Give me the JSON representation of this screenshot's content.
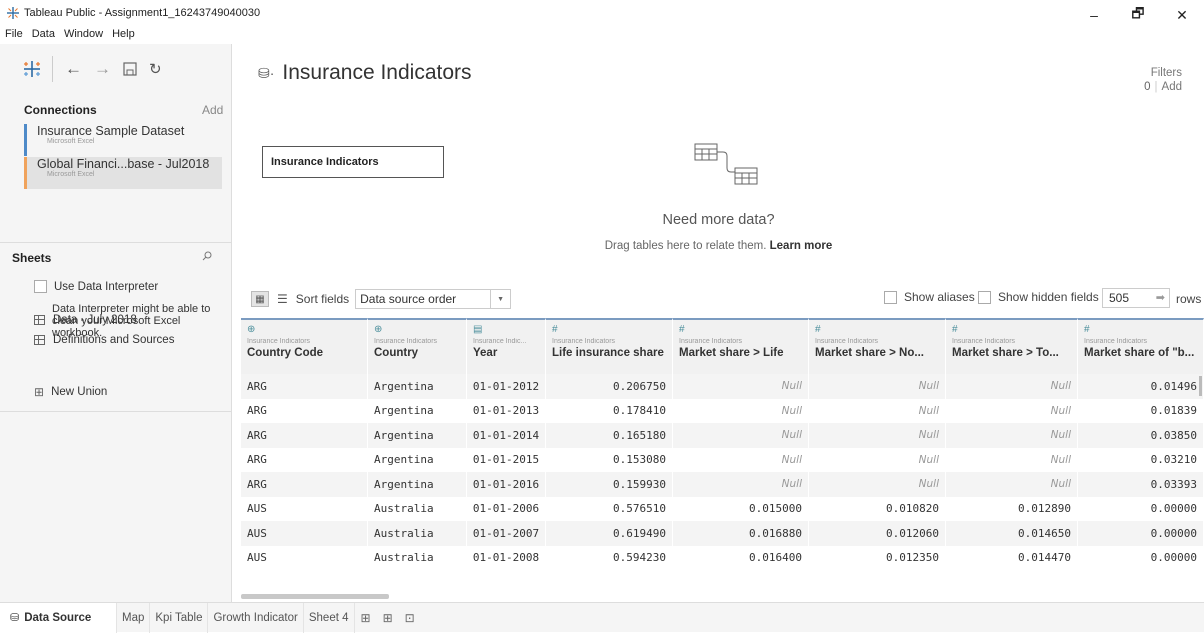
{
  "window": {
    "title": "Tableau Public - Assignment1_16243749040030",
    "minimize": "–",
    "maximize": "🗗",
    "close": "✕"
  },
  "menu": [
    "File",
    "Data",
    "Window",
    "Help"
  ],
  "left": {
    "connections_label": "Connections",
    "add_label": "Add",
    "connections": [
      {
        "name": "Insurance Sample Dataset",
        "type": "Microsoft Excel"
      },
      {
        "name": "Global Financi...base - Jul2018",
        "type": "Microsoft Excel"
      }
    ],
    "sheets_label": "Sheets",
    "use_interpreter": "Use Data Interpreter",
    "interpreter_desc": "Data Interpreter might be able to clean your Microsoft Excel workbook.",
    "sheets": [
      "Data - July 2018",
      "Definitions and Sources"
    ],
    "new_union": "New Union"
  },
  "main": {
    "datasource_title": "Insurance Indicators",
    "filters_label": "Filters",
    "filters_count": "0",
    "filters_add": "Add",
    "canvas_table": "Insurance Indicators",
    "need_more": "Need more data?",
    "drag_text": "Drag tables here to relate them.",
    "learn_more": "Learn more"
  },
  "gridbar": {
    "sort_label": "Sort fields",
    "sort_value": "Data source order",
    "show_aliases": "Show aliases",
    "show_hidden": "Show hidden fields",
    "rows_value": "505",
    "rows_label": "rows"
  },
  "grid": {
    "columns": [
      {
        "icon": "⊕",
        "source": "Insurance Indicators",
        "name": "Country Code"
      },
      {
        "icon": "⊕",
        "source": "Insurance Indicators",
        "name": "Country"
      },
      {
        "icon": "📅",
        "source": "Insurance Indic...",
        "name": "Year"
      },
      {
        "icon": "#",
        "source": "Insurance Indicators",
        "name": "Life insurance share"
      },
      {
        "icon": "#",
        "source": "Insurance Indicators",
        "name": "Market share > Life"
      },
      {
        "icon": "#",
        "source": "Insurance Indicators",
        "name": "Market share > No..."
      },
      {
        "icon": "#",
        "source": "Insurance Indicators",
        "name": "Market share > To..."
      },
      {
        "icon": "#",
        "source": "Insurance Indicators",
        "name": "Market share of \"b..."
      }
    ],
    "rows": [
      [
        "ARG",
        "Argentina",
        "01-01-2012",
        "0.206750",
        "Null",
        "Null",
        "Null",
        "0.01496"
      ],
      [
        "ARG",
        "Argentina",
        "01-01-2013",
        "0.178410",
        "Null",
        "Null",
        "Null",
        "0.01839"
      ],
      [
        "ARG",
        "Argentina",
        "01-01-2014",
        "0.165180",
        "Null",
        "Null",
        "Null",
        "0.03850"
      ],
      [
        "ARG",
        "Argentina",
        "01-01-2015",
        "0.153080",
        "Null",
        "Null",
        "Null",
        "0.03210"
      ],
      [
        "ARG",
        "Argentina",
        "01-01-2016",
        "0.159930",
        "Null",
        "Null",
        "Null",
        "0.03393"
      ],
      [
        "AUS",
        "Australia",
        "01-01-2006",
        "0.576510",
        "0.015000",
        "0.010820",
        "0.012890",
        "0.00000"
      ],
      [
        "AUS",
        "Australia",
        "01-01-2007",
        "0.619490",
        "0.016880",
        "0.012060",
        "0.014650",
        "0.00000"
      ],
      [
        "AUS",
        "Australia",
        "01-01-2008",
        "0.594230",
        "0.016400",
        "0.012350",
        "0.014470",
        "0.00000"
      ]
    ]
  },
  "tabs": {
    "data_source": "Data Source",
    "sheets": [
      "Map",
      "Kpi Table",
      "Growth Indicator",
      "Sheet 4"
    ]
  }
}
